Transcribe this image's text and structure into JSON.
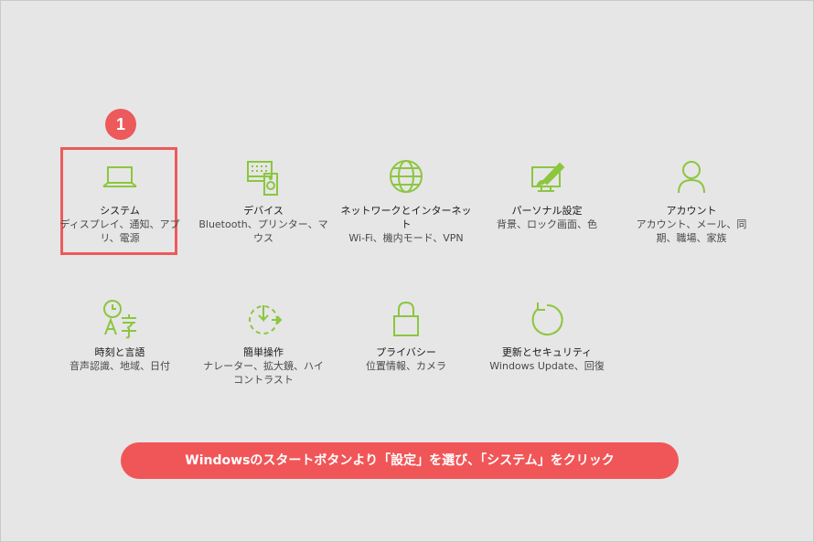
{
  "colors": {
    "background": "#e6e6e6",
    "icon_accent": "#8cc63f",
    "highlight": "#ec5a5c",
    "banner": "#f05658"
  },
  "step_badge": "1",
  "tiles": [
    {
      "label": "システム",
      "description": "ディスプレイ、通知、アプリ、電源",
      "icon": "laptop-icon",
      "highlighted": true
    },
    {
      "label": "デバイス",
      "description": "Bluetooth、プリンター、マウス",
      "icon": "devices-icon",
      "highlighted": false
    },
    {
      "label": "ネットワークとインターネット",
      "description": "Wi-Fi、機内モード、VPN",
      "icon": "globe-icon",
      "highlighted": false
    },
    {
      "label": "パーソナル設定",
      "description": "背景、ロック画面、色",
      "icon": "personalization-icon",
      "highlighted": false
    },
    {
      "label": "アカウント",
      "description": "アカウント、メール、同期、職場、家族",
      "icon": "person-icon",
      "highlighted": false
    },
    {
      "label": "時刻と言語",
      "description": "音声認識、地域、日付",
      "icon": "time-language-icon",
      "highlighted": false
    },
    {
      "label": "簡単操作",
      "description": "ナレーター、拡大鏡、ハイコントラスト",
      "icon": "ease-of-access-icon",
      "highlighted": false
    },
    {
      "label": "プライバシー",
      "description": "位置情報、カメラ",
      "icon": "lock-icon",
      "highlighted": false
    },
    {
      "label": "更新とセキュリティ",
      "description": "Windows Update、回復",
      "icon": "update-icon",
      "highlighted": false
    }
  ],
  "instruction": "Windowsのスタートボタンより「設定」を選び、「システム」をクリック"
}
